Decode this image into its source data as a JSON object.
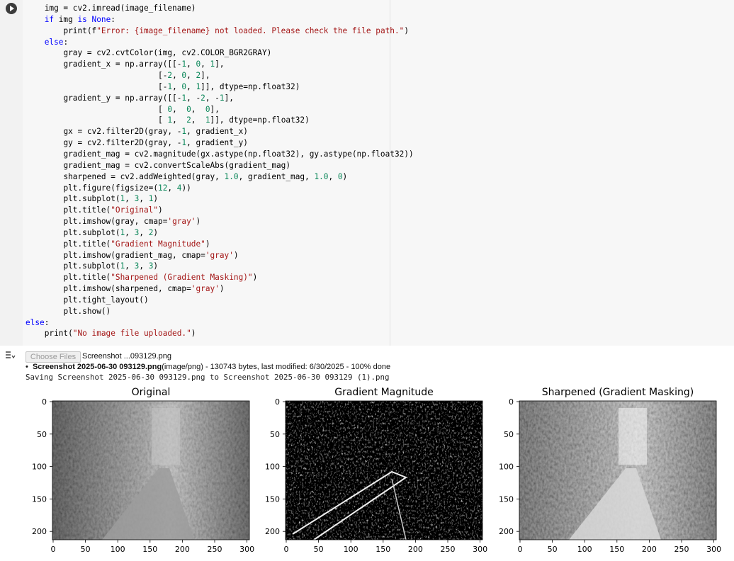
{
  "cell": {
    "code_lines": [
      {
        "indent": 4,
        "parts": [
          [
            "t",
            "img = cv2.imread(image_filename)"
          ]
        ]
      },
      {
        "indent": 4,
        "parts": [
          [
            "kw",
            "if"
          ],
          [
            "t",
            " img "
          ],
          [
            "kw",
            "is"
          ],
          [
            "t",
            " "
          ],
          [
            "kw",
            "None"
          ],
          [
            "t",
            ":"
          ]
        ]
      },
      {
        "indent": 8,
        "parts": [
          [
            "t",
            "print(f"
          ],
          [
            "str",
            "\"Error: {image_filename} not loaded. Please check the file path.\""
          ],
          [
            "t",
            ")"
          ]
        ]
      },
      {
        "indent": 4,
        "parts": [
          [
            "kw",
            "else"
          ],
          [
            "t",
            ":"
          ]
        ]
      },
      {
        "indent": 8,
        "parts": [
          [
            "t",
            "gray = cv2.cvtColor(img, cv2.COLOR_BGR2GRAY)"
          ]
        ]
      },
      {
        "indent": 8,
        "parts": [
          [
            "t",
            "gradient_x = np.array([[-"
          ],
          [
            "num",
            "1"
          ],
          [
            "t",
            ", "
          ],
          [
            "num",
            "0"
          ],
          [
            "t",
            ", "
          ],
          [
            "num",
            "1"
          ],
          [
            "t",
            "],"
          ]
        ]
      },
      {
        "indent": 28,
        "parts": [
          [
            "t",
            "[-"
          ],
          [
            "num",
            "2"
          ],
          [
            "t",
            ", "
          ],
          [
            "num",
            "0"
          ],
          [
            "t",
            ", "
          ],
          [
            "num",
            "2"
          ],
          [
            "t",
            "],"
          ]
        ]
      },
      {
        "indent": 28,
        "parts": [
          [
            "t",
            "[-"
          ],
          [
            "num",
            "1"
          ],
          [
            "t",
            ", "
          ],
          [
            "num",
            "0"
          ],
          [
            "t",
            ", "
          ],
          [
            "num",
            "1"
          ],
          [
            "t",
            "]], dtype=np.float32)"
          ]
        ]
      },
      {
        "indent": 8,
        "parts": [
          [
            "t",
            "gradient_y = np.array([[-"
          ],
          [
            "num",
            "1"
          ],
          [
            "t",
            ", -"
          ],
          [
            "num",
            "2"
          ],
          [
            "t",
            ", -"
          ],
          [
            "num",
            "1"
          ],
          [
            "t",
            "],"
          ]
        ]
      },
      {
        "indent": 28,
        "parts": [
          [
            "t",
            "[ "
          ],
          [
            "num",
            "0"
          ],
          [
            "t",
            ",  "
          ],
          [
            "num",
            "0"
          ],
          [
            "t",
            ",  "
          ],
          [
            "num",
            "0"
          ],
          [
            "t",
            "],"
          ]
        ]
      },
      {
        "indent": 28,
        "parts": [
          [
            "t",
            "[ "
          ],
          [
            "num",
            "1"
          ],
          [
            "t",
            ",  "
          ],
          [
            "num",
            "2"
          ],
          [
            "t",
            ",  "
          ],
          [
            "num",
            "1"
          ],
          [
            "t",
            "]], dtype=np.float32)"
          ]
        ]
      },
      {
        "indent": 8,
        "parts": [
          [
            "t",
            "gx = cv2.filter2D(gray, -"
          ],
          [
            "num",
            "1"
          ],
          [
            "t",
            ", gradient_x)"
          ]
        ]
      },
      {
        "indent": 8,
        "parts": [
          [
            "t",
            "gy = cv2.filter2D(gray, -"
          ],
          [
            "num",
            "1"
          ],
          [
            "t",
            ", gradient_y)"
          ]
        ]
      },
      {
        "indent": 8,
        "parts": [
          [
            "t",
            "gradient_mag = cv2.magnitude(gx.astype(np.float32), gy.astype(np.float32))"
          ]
        ]
      },
      {
        "indent": 8,
        "parts": [
          [
            "t",
            "gradient_mag = cv2.convertScaleAbs(gradient_mag)"
          ]
        ]
      },
      {
        "indent": 8,
        "parts": [
          [
            "t",
            "sharpened = cv2.addWeighted(gray, "
          ],
          [
            "num",
            "1.0"
          ],
          [
            "t",
            ", gradient_mag, "
          ],
          [
            "num",
            "1.0"
          ],
          [
            "t",
            ", "
          ],
          [
            "num",
            "0"
          ],
          [
            "t",
            ")"
          ]
        ]
      },
      {
        "indent": 8,
        "parts": [
          [
            "t",
            "plt.figure(figsize=("
          ],
          [
            "num",
            "12"
          ],
          [
            "t",
            ", "
          ],
          [
            "num",
            "4"
          ],
          [
            "t",
            "))"
          ]
        ]
      },
      {
        "indent": 8,
        "parts": [
          [
            "t",
            "plt.subplot("
          ],
          [
            "num",
            "1"
          ],
          [
            "t",
            ", "
          ],
          [
            "num",
            "3"
          ],
          [
            "t",
            ", "
          ],
          [
            "num",
            "1"
          ],
          [
            "t",
            ")"
          ]
        ]
      },
      {
        "indent": 8,
        "parts": [
          [
            "t",
            "plt.title("
          ],
          [
            "str",
            "\"Original\""
          ],
          [
            "t",
            ")"
          ]
        ]
      },
      {
        "indent": 8,
        "parts": [
          [
            "t",
            "plt.imshow(gray, cmap="
          ],
          [
            "str",
            "'gray'"
          ],
          [
            "t",
            ")"
          ]
        ]
      },
      {
        "indent": 8,
        "parts": [
          [
            "t",
            "plt.subplot("
          ],
          [
            "num",
            "1"
          ],
          [
            "t",
            ", "
          ],
          [
            "num",
            "3"
          ],
          [
            "t",
            ", "
          ],
          [
            "num",
            "2"
          ],
          [
            "t",
            ")"
          ]
        ]
      },
      {
        "indent": 8,
        "parts": [
          [
            "t",
            "plt.title("
          ],
          [
            "str",
            "\"Gradient Magnitude\""
          ],
          [
            "t",
            ")"
          ]
        ]
      },
      {
        "indent": 8,
        "parts": [
          [
            "t",
            "plt.imshow(gradient_mag, cmap="
          ],
          [
            "str",
            "'gray'"
          ],
          [
            "t",
            ")"
          ]
        ]
      },
      {
        "indent": 8,
        "parts": [
          [
            "t",
            "plt.subplot("
          ],
          [
            "num",
            "1"
          ],
          [
            "t",
            ", "
          ],
          [
            "num",
            "3"
          ],
          [
            "t",
            ", "
          ],
          [
            "num",
            "3"
          ],
          [
            "t",
            ")"
          ]
        ]
      },
      {
        "indent": 8,
        "parts": [
          [
            "t",
            "plt.title("
          ],
          [
            "str",
            "\"Sharpened (Gradient Masking)\""
          ],
          [
            "t",
            ")"
          ]
        ]
      },
      {
        "indent": 8,
        "parts": [
          [
            "t",
            "plt.imshow(sharpened, cmap="
          ],
          [
            "str",
            "'gray'"
          ],
          [
            "t",
            ")"
          ]
        ]
      },
      {
        "indent": 8,
        "parts": [
          [
            "t",
            "plt.tight_layout()"
          ]
        ]
      },
      {
        "indent": 8,
        "parts": [
          [
            "t",
            "plt.show()"
          ]
        ]
      },
      {
        "indent": 0,
        "parts": [
          [
            "kw",
            "else"
          ],
          [
            "t",
            ":"
          ]
        ]
      },
      {
        "indent": 4,
        "parts": [
          [
            "t",
            "print("
          ],
          [
            "str",
            "\"No image file uploaded.\""
          ],
          [
            "t",
            ")"
          ]
        ]
      }
    ]
  },
  "output": {
    "choose_button": "Choose Files",
    "chosen_file": "Screenshot ...093129.png",
    "upload_name": "Screenshot 2025-06-30 093129.png",
    "upload_detail": "(image/png) - 130743 bytes, last modified: 6/30/2025 - 100% done",
    "saving_line": "Saving Screenshot 2025-06-30 093129.png to Screenshot 2025-06-30 093129 (1).png"
  },
  "figure": {
    "panels": [
      {
        "title": "Original",
        "style": "original"
      },
      {
        "title": "Gradient Magnitude",
        "style": "gradient"
      },
      {
        "title": "Sharpened (Gradient Masking)",
        "style": "sharpened"
      }
    ],
    "x_ticks": [
      "0",
      "50",
      "100",
      "150",
      "200",
      "250",
      "300"
    ],
    "y_ticks": [
      "0",
      "50",
      "100",
      "150",
      "200"
    ]
  }
}
